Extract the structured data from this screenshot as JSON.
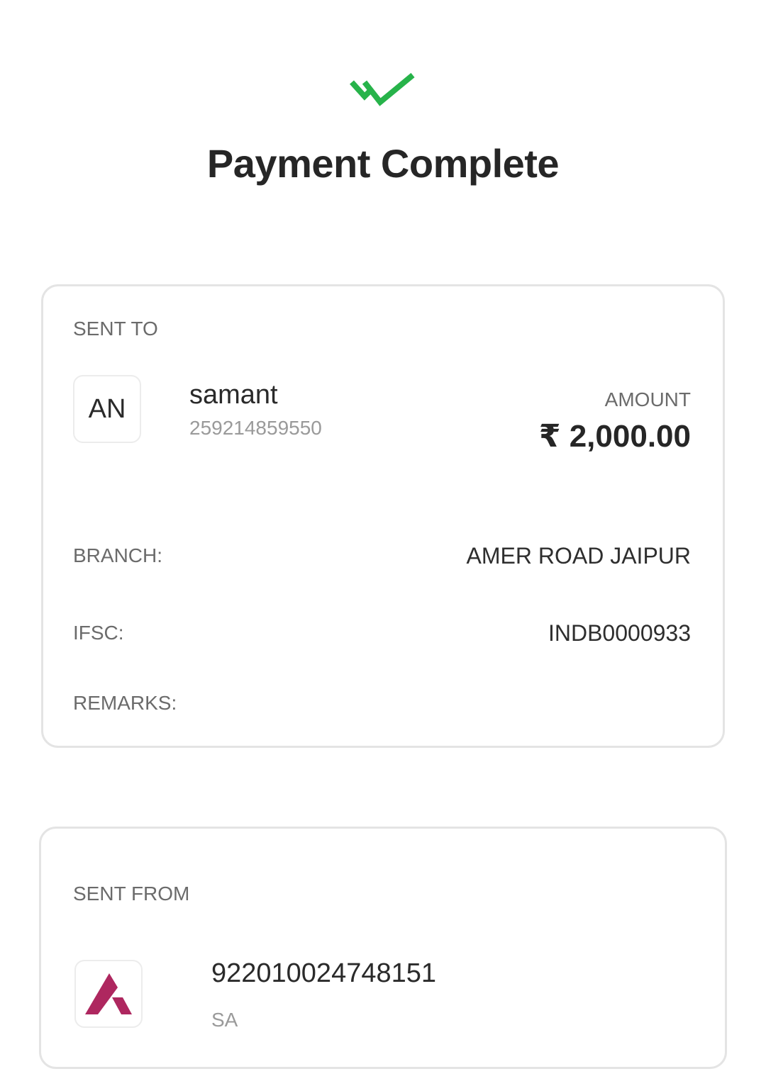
{
  "header": {
    "title": "Payment Complete",
    "status_icon": "double-check-icon",
    "status_color": "#27b34a"
  },
  "sent_to": {
    "section_label": "SENT TO",
    "avatar_initials": "AN",
    "name": "samant",
    "account_number": "259214859550",
    "amount_label": "AMOUNT",
    "amount": "₹ 2,000.00",
    "branch_label": "BRANCH:",
    "branch": "AMER ROAD JAIPUR",
    "ifsc_label": "IFSC:",
    "ifsc": "INDB0000933",
    "remarks_label": "REMARKS:",
    "remarks": ""
  },
  "sent_from": {
    "section_label": "SENT FROM",
    "bank_logo_icon": "axis-bank-logo-icon",
    "bank_logo_color": "#ae275f",
    "account_number": "922010024748151",
    "account_type": "SA"
  }
}
